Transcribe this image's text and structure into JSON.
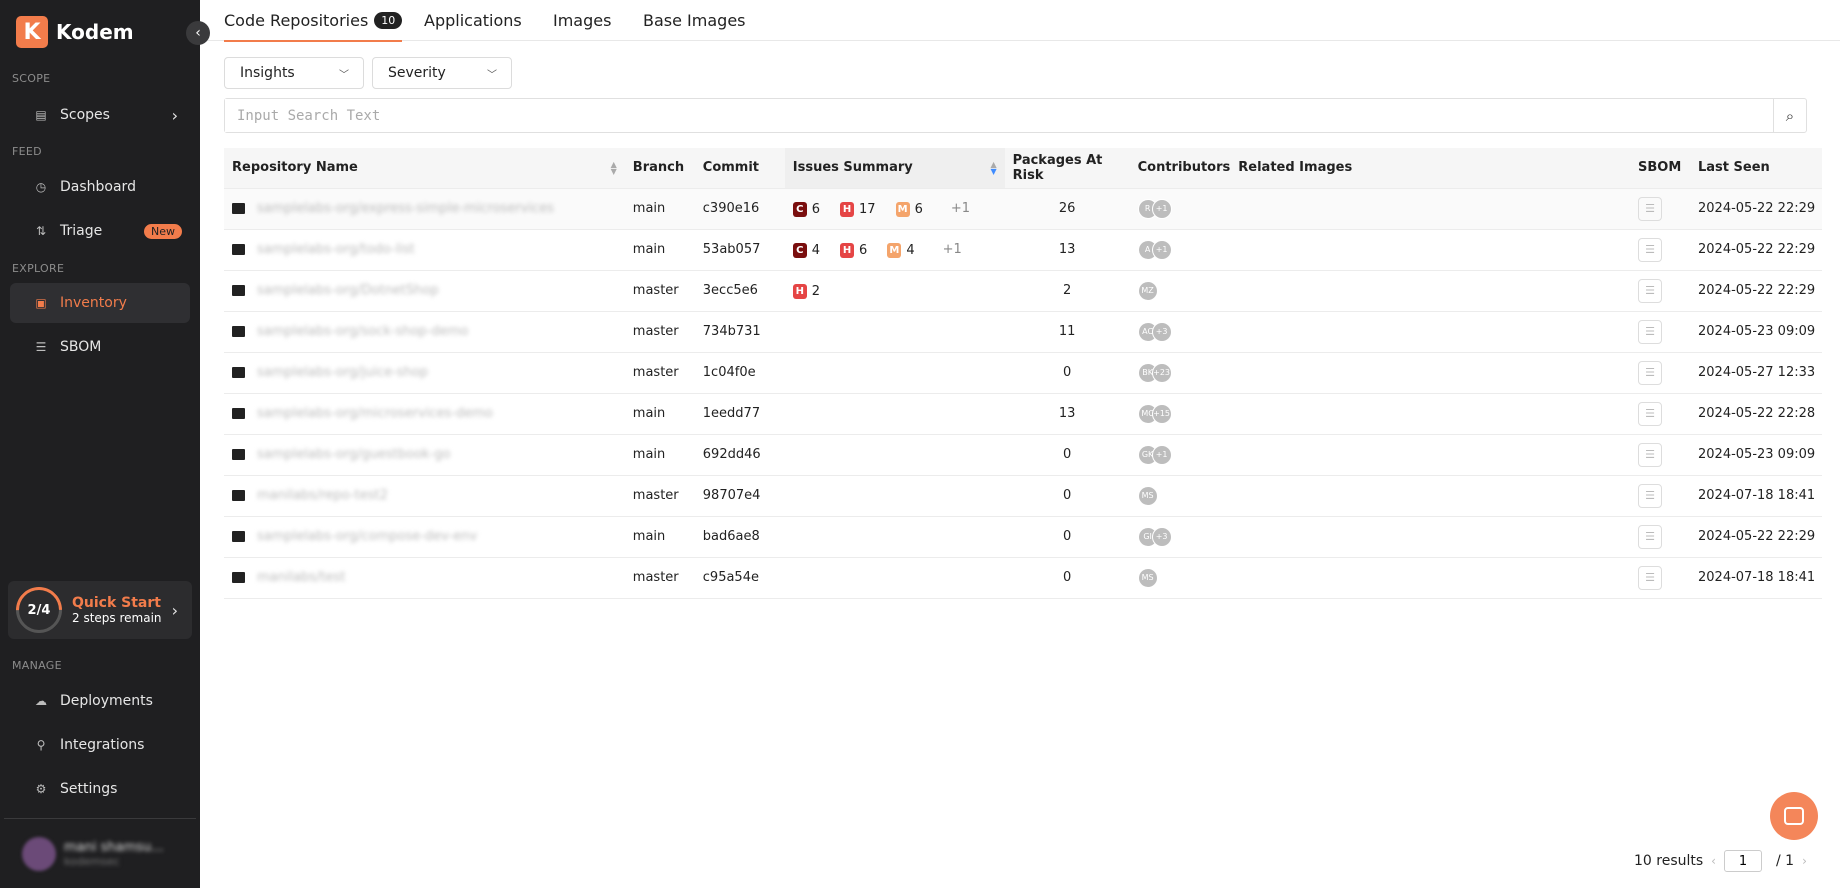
{
  "brand": {
    "letter": "K",
    "name": "Kodem",
    "accent": "#f27c4b"
  },
  "sidebar": {
    "scope_label": "SCOPE",
    "scopes": "Scopes",
    "feed_label": "FEED",
    "dashboard": "Dashboard",
    "triage": "Triage",
    "triage_badge": "New",
    "explore_label": "EXPLORE",
    "inventory": "Inventory",
    "sbom": "SBOM",
    "quick_start": {
      "progress": "2/4",
      "title": "Quick Start",
      "subtitle": "2 steps remain"
    },
    "manage_label": "MANAGE",
    "deployments": "Deployments",
    "integrations": "Integrations",
    "settings": "Settings",
    "user": {
      "name": "mani shamsu...",
      "sub": "kodemsec"
    }
  },
  "tabs": [
    {
      "label": "Code Repositories",
      "count": "10"
    },
    {
      "label": "Applications"
    },
    {
      "label": "Images"
    },
    {
      "label": "Base Images"
    }
  ],
  "filters": {
    "insights": "Insights",
    "severity": "Severity"
  },
  "search": {
    "placeholder": "Input Search Text"
  },
  "table": {
    "headers": [
      "Repository Name",
      "Branch",
      "Commit",
      "Issues Summary",
      "Packages At Risk",
      "Contributors",
      "Related Images",
      "SBOM",
      "Last Seen"
    ],
    "rows": [
      {
        "repo": "samplelabs-org/express-simple-microservices",
        "branch": "main",
        "commit": "c390e16",
        "c": "6",
        "h": "17",
        "m": "6",
        "more": "+1",
        "packages": "26",
        "contributors": [
          "R",
          "+1"
        ],
        "last_seen": "2024-05-22 22:29"
      },
      {
        "repo": "samplelabs-org/todo-list",
        "branch": "main",
        "commit": "53ab057",
        "c": "4",
        "h": "6",
        "m": "4",
        "more": "+1",
        "packages": "13",
        "contributors": [
          "A",
          "+1"
        ],
        "last_seen": "2024-05-22 22:29"
      },
      {
        "repo": "samplelabs-org/DotnetShop",
        "branch": "master",
        "commit": "3ecc5e6",
        "h": "2",
        "packages": "2",
        "contributors": [
          "MZ"
        ],
        "last_seen": "2024-05-22 22:29"
      },
      {
        "repo": "samplelabs-org/sock-shop-demo",
        "branch": "master",
        "commit": "734b731",
        "packages": "11",
        "contributors": [
          "AC",
          "+3"
        ],
        "last_seen": "2024-05-23 09:09"
      },
      {
        "repo": "samplelabs-org/juice-shop",
        "branch": "master",
        "commit": "1c04f0e",
        "packages": "0",
        "contributors": [
          "BK",
          "+23"
        ],
        "last_seen": "2024-05-27 12:33"
      },
      {
        "repo": "samplelabs-org/microservices-demo",
        "branch": "main",
        "commit": "1eedd77",
        "packages": "13",
        "contributors": [
          "MC",
          "+15"
        ],
        "last_seen": "2024-05-22 22:28"
      },
      {
        "repo": "samplelabs-org/guestbook-go",
        "branch": "main",
        "commit": "692dd46",
        "packages": "0",
        "contributors": [
          "GK",
          "+1"
        ],
        "last_seen": "2024-05-23 09:09"
      },
      {
        "repo": "manilabs/repo-test2",
        "branch": "master",
        "commit": "98707e4",
        "packages": "0",
        "contributors": [
          "MS"
        ],
        "last_seen": "2024-07-18 18:41"
      },
      {
        "repo": "samplelabs-org/compose-dev-env",
        "branch": "main",
        "commit": "bad6ae8",
        "packages": "0",
        "contributors": [
          "GI",
          "+3"
        ],
        "last_seen": "2024-05-22 22:29"
      },
      {
        "repo": "manilabs/test",
        "branch": "master",
        "commit": "c95a54e",
        "packages": "0",
        "contributors": [
          "MS"
        ],
        "last_seen": "2024-07-18 18:41"
      }
    ]
  },
  "pagination": {
    "results": "10 results",
    "page": "1",
    "total": "/  1"
  }
}
